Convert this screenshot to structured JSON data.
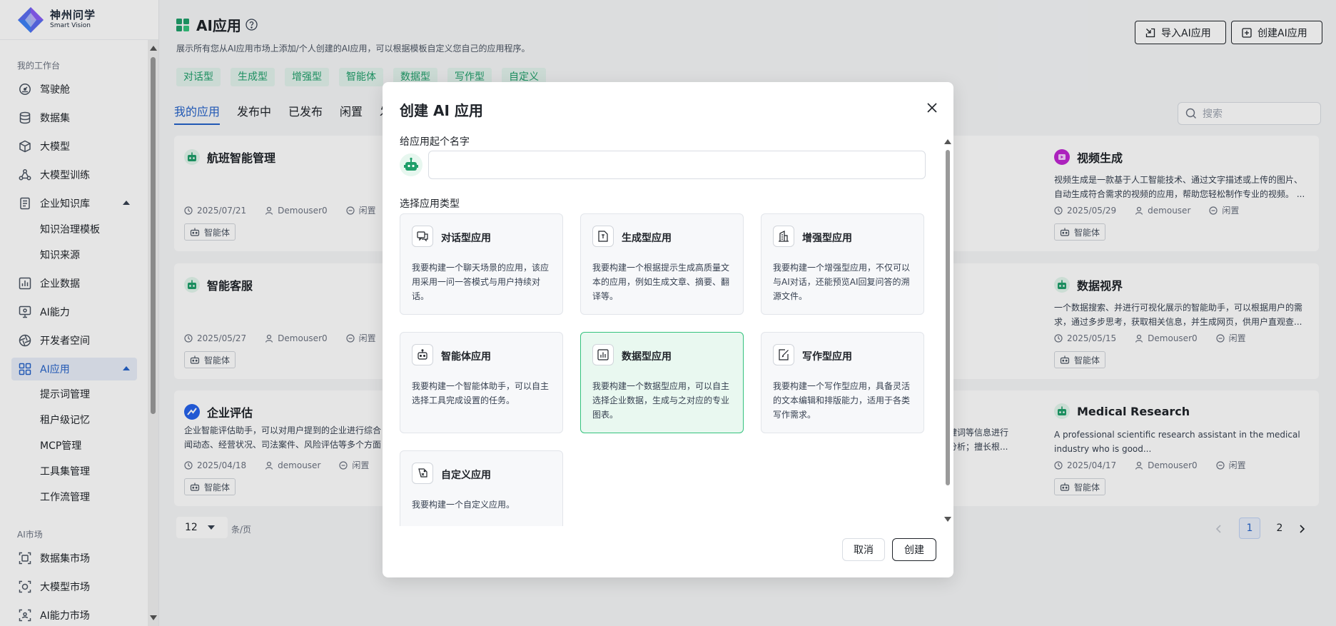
{
  "brand": {
    "name_cn": "神州问学",
    "name_en": "Smart Vision"
  },
  "sidebar": {
    "section_workspace": "我的工作台",
    "items": [
      {
        "label": "驾驶舱",
        "icon": "dashboard-icon"
      },
      {
        "label": "数据集",
        "icon": "database-icon"
      },
      {
        "label": "大模型",
        "icon": "cube-icon"
      },
      {
        "label": "大模型训练",
        "icon": "training-icon"
      },
      {
        "label": "企业知识库",
        "icon": "knowledge-icon",
        "expanded": true
      },
      {
        "label": "企业数据",
        "icon": "bar-chart-icon"
      },
      {
        "label": "AI能力",
        "icon": "ai-monitor-icon"
      },
      {
        "label": "开发者空间",
        "icon": "aperture-icon"
      },
      {
        "label": "AI应用",
        "icon": "grid-icon",
        "active": true,
        "expanded": true
      }
    ],
    "knowledge_sub": [
      "知识治理模板",
      "知识来源"
    ],
    "app_sub": [
      "提示词管理",
      "租户级记忆",
      "MCP管理",
      "工具集管理",
      "工作流管理"
    ],
    "section_market": "AI市场",
    "market_items": [
      {
        "label": "数据集市场",
        "icon": "scan-icon"
      },
      {
        "label": "大模型市场",
        "icon": "scan-icon"
      },
      {
        "label": "AI能力市场",
        "icon": "scan-icon"
      }
    ]
  },
  "header": {
    "title": "AI应用",
    "description": "展示所有您从AI应用市场上添加/个人创建的AI应用，可以根据模板自定义您自己的应用程序。",
    "import_button": "导入AI应用",
    "create_button": "创建AI应用"
  },
  "filter_chips": [
    "对话型",
    "生成型",
    "增强型",
    "智能体",
    "数据型",
    "写作型",
    "自定义"
  ],
  "tabs": [
    "我的应用",
    "发布中",
    "已发布",
    "闲置",
    "发"
  ],
  "search": {
    "placeholder": "搜索"
  },
  "cards_left": [
    {
      "title": "航班智能管理",
      "desc": "",
      "date": "2025/07/21",
      "user": "Demouser0",
      "status": "闲置",
      "tag": "智能体",
      "avatar": "robot"
    },
    {
      "title": "智能客服",
      "desc": "",
      "date": "2025/05/27",
      "user": "Demouser0",
      "status": "闲置",
      "tag": "智能体",
      "avatar": "robot"
    },
    {
      "title": "企业评估",
      "desc": "企业智能评估助手，可以对用户提到的企业进行综合\n闻动态、经营状况、司法案件、风险评估等多个方面",
      "date": "2025/04/18",
      "user": "demouser",
      "status": "闲置",
      "tag": "智能体",
      "avatar": "trend"
    }
  ],
  "cards_right": [
    {
      "title": "视频生成",
      "desc": "视频生成是一款基于人工智能技术、通过文字描述或上传的图片、自动生成符合需求的视频的应用，帮助您轻松制作专业的视频。 ...",
      "date": "2025/05/29",
      "user": "demouser",
      "status": "闲置",
      "tag": "智能体",
      "avatar": "video"
    },
    {
      "title": "数据视界",
      "desc": "一个数据搜索、并进行可视化展示的智能助手，可以根据用户的需求，通过多步思考，获取相关信息，并生成网页，供用户直观查...",
      "date": "2025/05/15",
      "user": "Demouser0",
      "status": "闲置",
      "tag": "智能体",
      "avatar": "robot"
    },
    {
      "title": "Medical Research",
      "desc": "A professional scientific research assistant in the medical industry who is good...",
      "date": "2025/04/17",
      "user": "Demouser0",
      "status": "闲置",
      "tag": "智能体",
      "avatar": "robot"
    }
  ],
  "card_fragments": {
    "line1": "键词等信息进行",
    "line2": "分析；擅长根..."
  },
  "pagination": {
    "page_size": "12",
    "page_size_suffix": "条/页",
    "pages": [
      "1",
      "2"
    ],
    "current": "1"
  },
  "modal": {
    "title": "创建 AI 应用",
    "name_label": "给应用起个名字",
    "name_value": "",
    "type_label": "选择应用类型",
    "types": [
      {
        "name": "对话型应用",
        "desc": "我要构建一个聊天场景的应用，该应用采用一问一答模式与用户持续对话。",
        "icon": "chat-icon"
      },
      {
        "name": "生成型应用",
        "desc": "我要构建一个根据提示生成高质量文本的应用，例如生成文章、摘要、翻译等。",
        "icon": "document-icon"
      },
      {
        "name": "增强型应用",
        "desc": "我要构建一个增强型应用，不仅可以与AI对话，还能预览AI回复问答的溯源文件。",
        "icon": "building-icon"
      },
      {
        "name": "智能体应用",
        "desc": "我要构建一个智能体助手，可以自主选择工具完成设置的任务。",
        "icon": "robot-icon"
      },
      {
        "name": "数据型应用",
        "desc": "我要构建一个数据型应用，可以自主选择企业数据，生成与之对应的专业图表。",
        "icon": "chart-icon",
        "selected": true
      },
      {
        "name": "写作型应用",
        "desc": "我要构建一个写作型应用，具备灵活的文本编辑和排版能力，适用于各类写作需求。",
        "icon": "edit-icon"
      },
      {
        "name": "自定义应用",
        "desc": "我要构建一个自定义应用。",
        "icon": "custom-icon"
      }
    ],
    "cancel_button": "取消",
    "create_button": "创建"
  },
  "colors": {
    "accent": "#2563c9",
    "green": "#1f9f6a",
    "selected_bg": "#e9f8f0",
    "selected_border": "#34c27d"
  }
}
